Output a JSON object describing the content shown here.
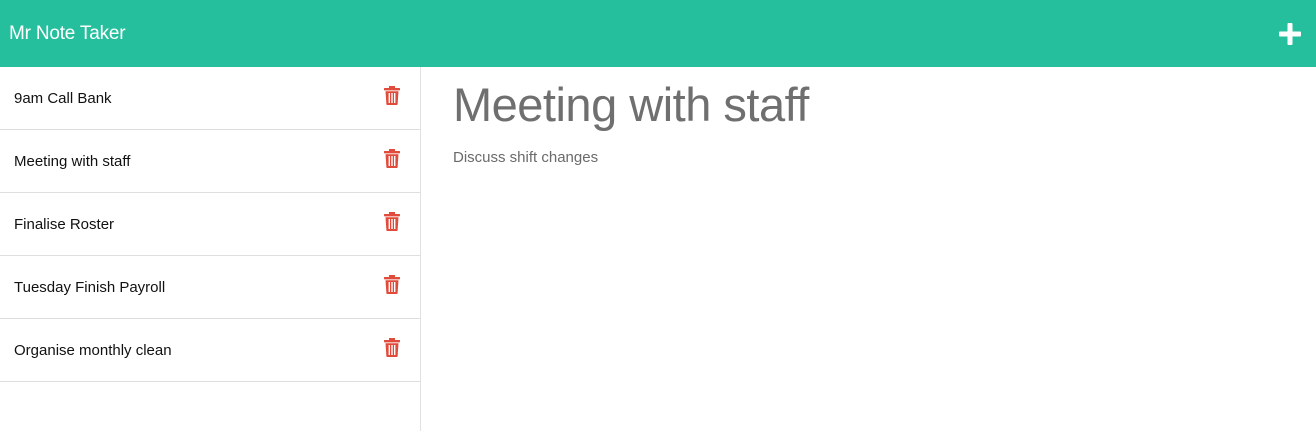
{
  "app": {
    "title": "Mr Note Taker"
  },
  "colors": {
    "brand": "#26bf9d",
    "delete": "#e14b3b"
  },
  "icons": {
    "add": "plus-icon",
    "delete": "trash-icon"
  },
  "notes": [
    {
      "title": "9am Call Bank"
    },
    {
      "title": "Meeting with staff"
    },
    {
      "title": "Finalise Roster"
    },
    {
      "title": "Tuesday Finish Payroll"
    },
    {
      "title": "Organise monthly clean"
    }
  ],
  "active_note": {
    "title": "Meeting with staff",
    "text": "Discuss shift changes"
  }
}
